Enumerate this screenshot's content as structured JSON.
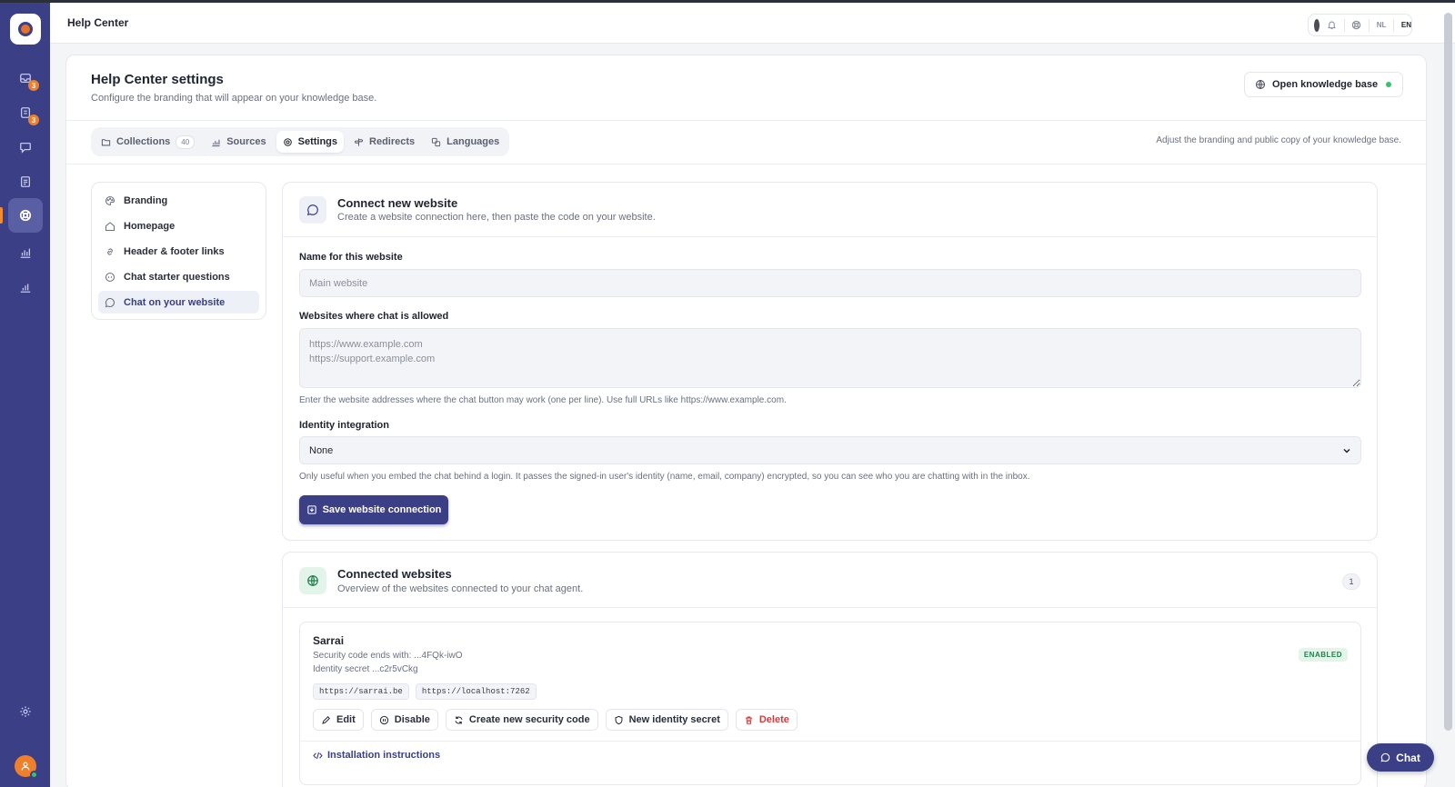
{
  "header": {
    "title": "Help Center",
    "languages": [
      "NL",
      "EN"
    ],
    "active_language": "EN"
  },
  "rail": {
    "items": [
      {
        "icon": "inbox-icon",
        "badge": "3"
      },
      {
        "icon": "tasks-icon",
        "badge": "3"
      },
      {
        "icon": "chat-icon"
      },
      {
        "icon": "document-icon"
      },
      {
        "icon": "help-center-icon",
        "active": true
      },
      {
        "icon": "chart-icon"
      },
      {
        "icon": "analytics-icon"
      }
    ],
    "settings_icon": "gear-icon",
    "avatar_icon": "user-icon"
  },
  "page": {
    "title": "Help Center settings",
    "subtitle": "Configure the branding that will appear on your knowledge base.",
    "open_kb_label": "Open knowledge base"
  },
  "tabs": {
    "items": [
      {
        "label": "Collections",
        "count": "40"
      },
      {
        "label": "Sources"
      },
      {
        "label": "Settings",
        "active": true
      },
      {
        "label": "Redirects"
      },
      {
        "label": "Languages"
      }
    ],
    "hint": "Adjust the branding and public copy of your knowledge base."
  },
  "sidebar": {
    "items": [
      {
        "label": "Branding"
      },
      {
        "label": "Homepage"
      },
      {
        "label": "Header & footer links"
      },
      {
        "label": "Chat starter questions"
      },
      {
        "label": "Chat on your website",
        "active": true
      }
    ]
  },
  "connect": {
    "title": "Connect new website",
    "subtitle": "Create a website connection here, then paste the code on your website.",
    "name_label": "Name for this website",
    "name_placeholder": "Main website",
    "allowed_label": "Websites where chat is allowed",
    "allowed_placeholder": "https://www.example.com\nhttps://support.example.com",
    "allowed_help": "Enter the website addresses where the chat button may work (one per line). Use full URLs like https://www.example.com.",
    "identity_label": "Identity integration",
    "identity_value": "None",
    "identity_help": "Only useful when you embed the chat behind a login. It passes the signed-in user's identity (name, email, company) encrypted, so you can see who you are chatting with in the inbox.",
    "save_label": "Save website connection"
  },
  "connected": {
    "title": "Connected websites",
    "subtitle": "Overview of the websites connected to your chat agent.",
    "count": "1",
    "site": {
      "name": "Sarrai",
      "security_code": "Security code ends with: ...4FQk-iwO",
      "identity_secret": "Identity secret ...c2r5vCkg",
      "status": "ENABLED",
      "domains": [
        "https://sarrai.be",
        "https://localhost:7262"
      ],
      "actions": {
        "edit": "Edit",
        "disable": "Disable",
        "new_code": "Create new security code",
        "new_secret": "New identity secret",
        "delete": "Delete"
      },
      "install_label": "Installation instructions"
    }
  },
  "chat_fab": {
    "label": "Chat"
  },
  "colors": {
    "rail": "#3b3f86",
    "accent": "#3b3f86",
    "orange": "#ef7f2b",
    "success": "#36c26b",
    "danger": "#d83a3a"
  }
}
